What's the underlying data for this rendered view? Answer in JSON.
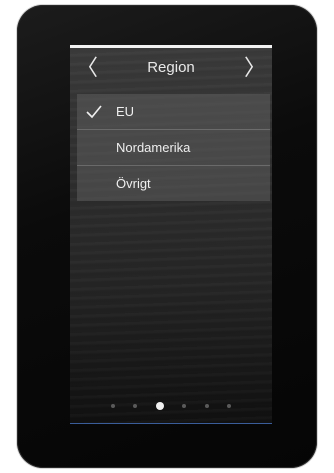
{
  "header": {
    "title": "Region",
    "prev_icon": "〈",
    "next_icon": "〉"
  },
  "region_list": {
    "items": [
      {
        "label": "EU",
        "selected": true
      },
      {
        "label": "Nordamerika",
        "selected": false
      },
      {
        "label": "Övrigt",
        "selected": false
      }
    ]
  },
  "pagination": {
    "page_count": 6,
    "active_index": 2
  },
  "colors": {
    "text": "#efefef",
    "accent_line": "#3a5d9a"
  }
}
